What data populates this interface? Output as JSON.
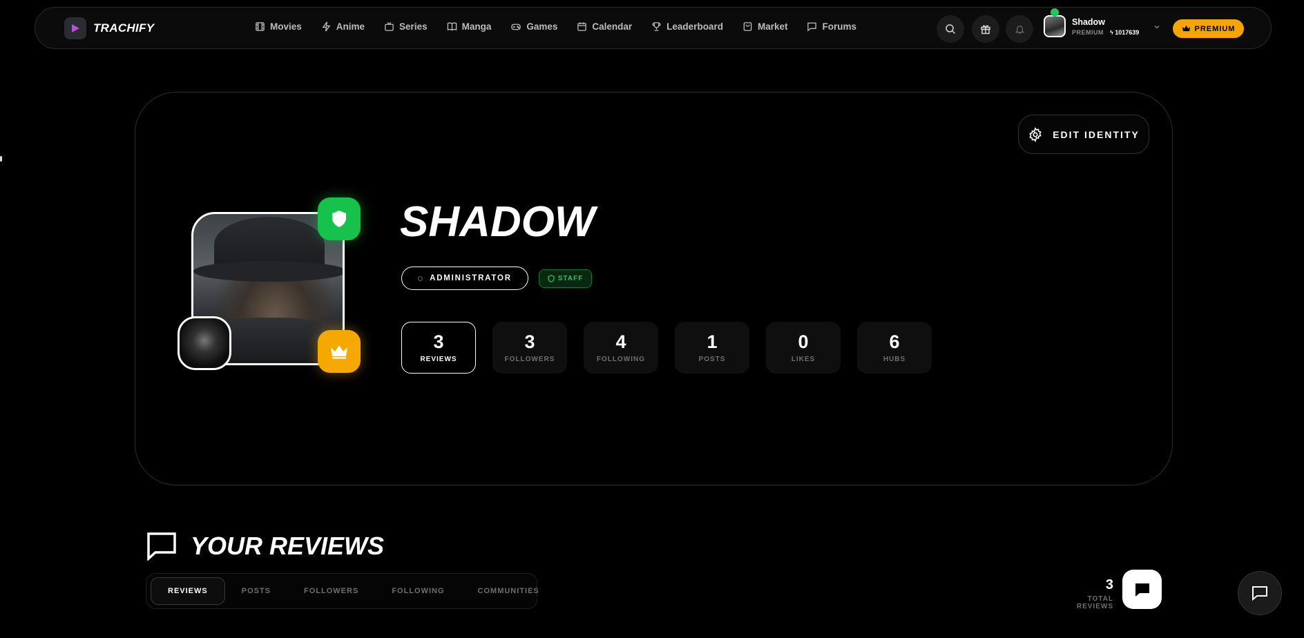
{
  "nav": {
    "brand": "TRACHIFY",
    "items": [
      {
        "label": "Movies",
        "icon": "film-icon"
      },
      {
        "label": "Anime",
        "icon": "bolt-icon"
      },
      {
        "label": "Series",
        "icon": "tv-icon"
      },
      {
        "label": "Manga",
        "icon": "book-icon"
      },
      {
        "label": "Games",
        "icon": "gamepad-icon"
      },
      {
        "label": "Calendar",
        "icon": "calendar-icon"
      },
      {
        "label": "Leaderboard",
        "icon": "trophy-icon"
      },
      {
        "label": "Market",
        "icon": "bag-icon"
      },
      {
        "label": "Forums",
        "icon": "chat-icon"
      }
    ],
    "user": {
      "name": "Shadow",
      "tier": "PREMIUM",
      "points": "1017639",
      "online_color": "#22c55e"
    },
    "premium_label": "PREMIUM",
    "accent": "#f5a500"
  },
  "profile": {
    "edit_label": "EDIT IDENTITY",
    "name": "SHADOW",
    "role": "ADMINISTRATOR",
    "staff_label": "STAFF",
    "stats": [
      {
        "value": "3",
        "label": "REVIEWS"
      },
      {
        "value": "3",
        "label": "FOLLOWERS"
      },
      {
        "value": "4",
        "label": "FOLLOWING"
      },
      {
        "value": "1",
        "label": "POSTS"
      },
      {
        "value": "0",
        "label": "LIKES"
      },
      {
        "value": "6",
        "label": "HUBS"
      }
    ],
    "badge_colors": {
      "shield": "#16c24c",
      "crown": "#f5a800"
    }
  },
  "reviews": {
    "title": "YOUR REVIEWS",
    "tabs": [
      "REVIEWS",
      "POSTS",
      "FOLLOWERS",
      "FOLLOWING",
      "COMMUNITIES"
    ],
    "total": "3",
    "total_label": "TOTAL REVIEWS"
  }
}
